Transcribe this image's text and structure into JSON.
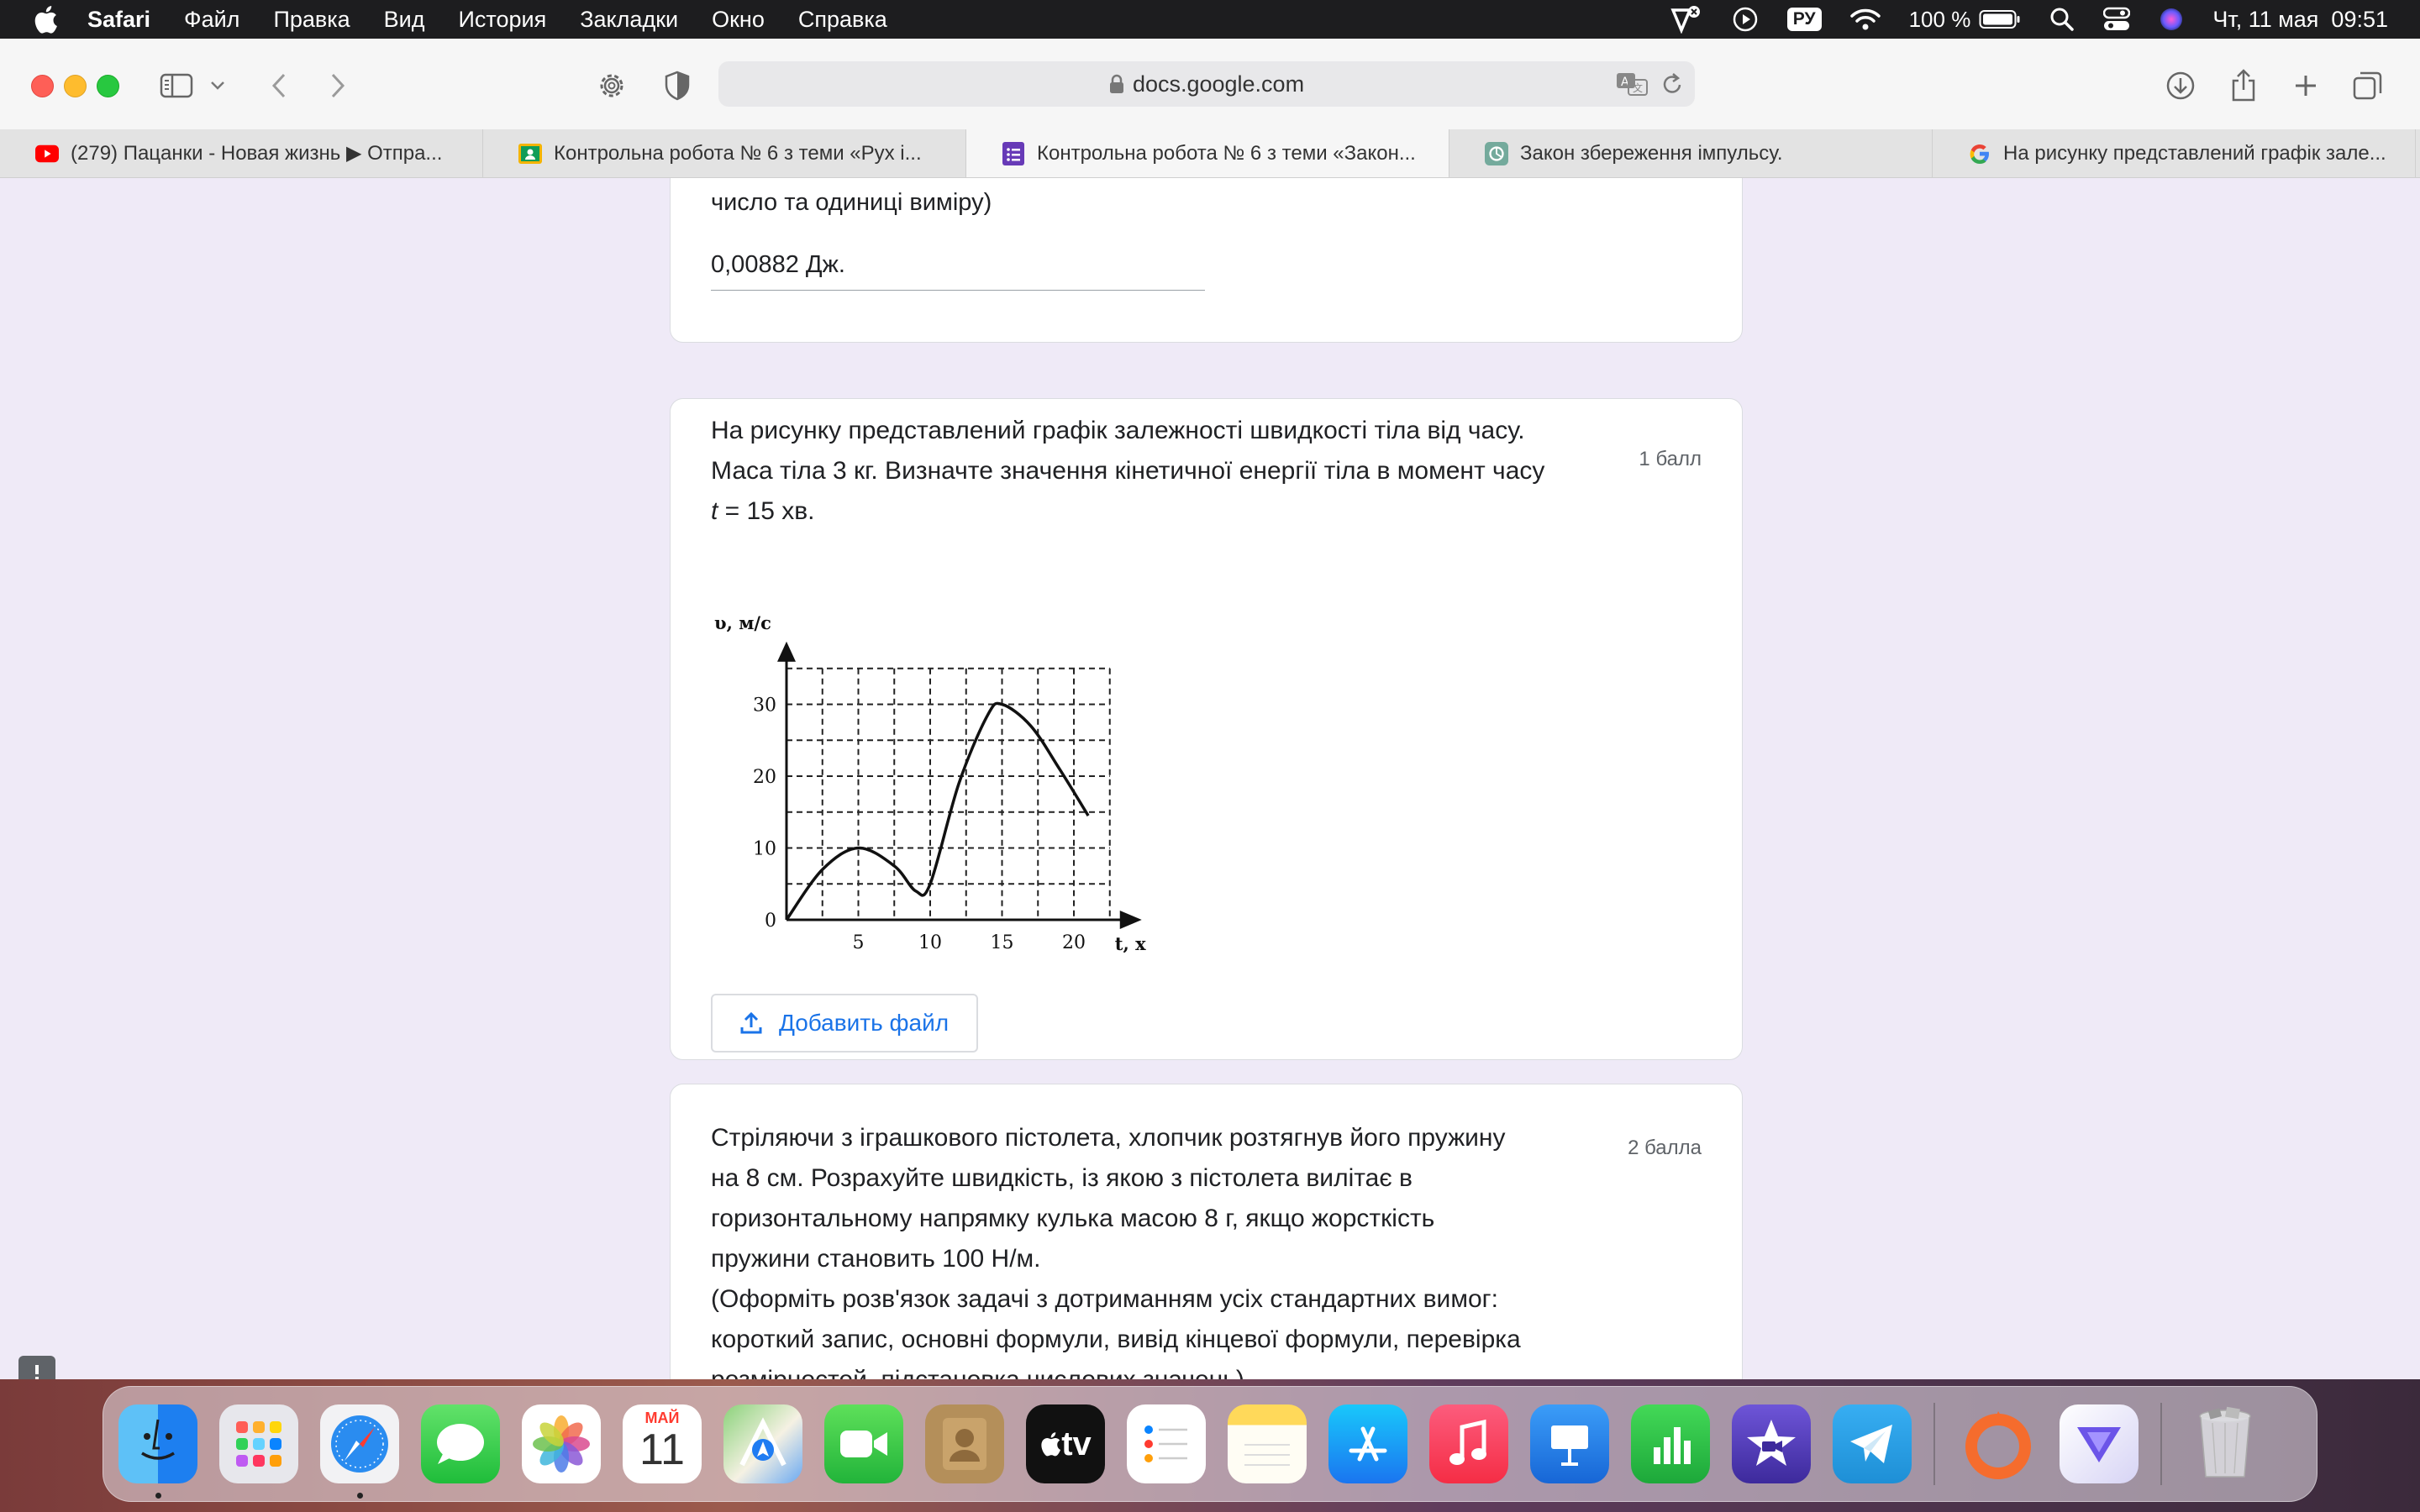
{
  "menubar": {
    "app_name": "Safari",
    "items": [
      "Файл",
      "Правка",
      "Вид",
      "История",
      "Закладки",
      "Окно",
      "Справка"
    ],
    "input_lang": "РУ",
    "battery": "100 %",
    "datetime": "Чт, 11 мая  09:51"
  },
  "browser": {
    "url": "docs.google.com",
    "tabs": [
      {
        "label": "(279) Пацанки - Новая жизнь ▶ Отпра...",
        "icon": "youtube-icon"
      },
      {
        "label": "Контрольна робота № 6 з теми «Рух і...",
        "icon": "classroom-icon"
      },
      {
        "label": "Контрольна робота № 6 з теми «Закон...",
        "icon": "google-forms-icon"
      },
      {
        "label": "Закон збереження імпульсу.",
        "icon": "chatgpt-icon"
      },
      {
        "label": "На рисунку представлений графік зале...",
        "icon": "google-icon"
      }
    ],
    "active_tab": 2
  },
  "form": {
    "prev_clipped_text": "число та одиниці виміру)",
    "prev_answer": "0,00882 Дж.",
    "q1": {
      "line1": "На рисунку представлений графік залежності швидкості тіла від часу.",
      "line2": "Маса тіла 3 кг. Визначте значення кінетичної енергії тіла в момент часу",
      "line3_italic": "t",
      "line3_rest": " = 15 хв.",
      "points": "1 балл",
      "upload_label": "Добавить файл"
    },
    "q2": {
      "lines": [
        "Стріляючи з іграшкового пістолета, хлопчик розтягнув його пружину",
        "на 8 см. Розрахуйте швидкість, із якою з пістолета вилітає в",
        "горизонтальному напрямку кулька масою 8 г, якщо жорсткість",
        "пружини становить 100 Н/м.",
        "(Оформіть розв'язок задачі з дотриманням усіх стандартних вимог:",
        "короткий запис, основні формули, вивід кінцевої формули, перевірка",
        "розмірностей, підстановка числових значень)."
      ],
      "points": "2 балла"
    }
  },
  "chart_data": {
    "type": "line",
    "title": "",
    "xlabel": "t, хв",
    "ylabel": "υ, м/с",
    "xlim": [
      0,
      22
    ],
    "ylim": [
      0,
      38
    ],
    "x_ticks": [
      5,
      10,
      15,
      20
    ],
    "y_ticks": [
      0,
      10,
      20,
      30
    ],
    "grid": true,
    "grid_style": "dashed",
    "x": [
      0,
      2.5,
      5,
      7.5,
      9,
      10,
      12,
      14,
      15,
      17,
      19,
      21
    ],
    "y": [
      0,
      7,
      10,
      7.5,
      4,
      5,
      19,
      28.5,
      30,
      27,
      21,
      14.5
    ]
  },
  "dock": {
    "calendar_month": "МАЙ",
    "calendar_day": "11",
    "apps": [
      "finder-icon",
      "launchpad-icon",
      "safari-icon",
      "messages-icon",
      "photos-icon",
      "calendar-icon",
      "maps-icon",
      "facetime-icon",
      "contacts-icon",
      "appletv-icon",
      "reminders-icon",
      "notes-icon",
      "appstore-icon",
      "music-icon",
      "keynote-icon",
      "numbers-icon",
      "imovie-icon",
      "telegram-icon",
      "origin-icon",
      "vpn-icon",
      "trash-icon"
    ],
    "appletv_label": "tv"
  }
}
